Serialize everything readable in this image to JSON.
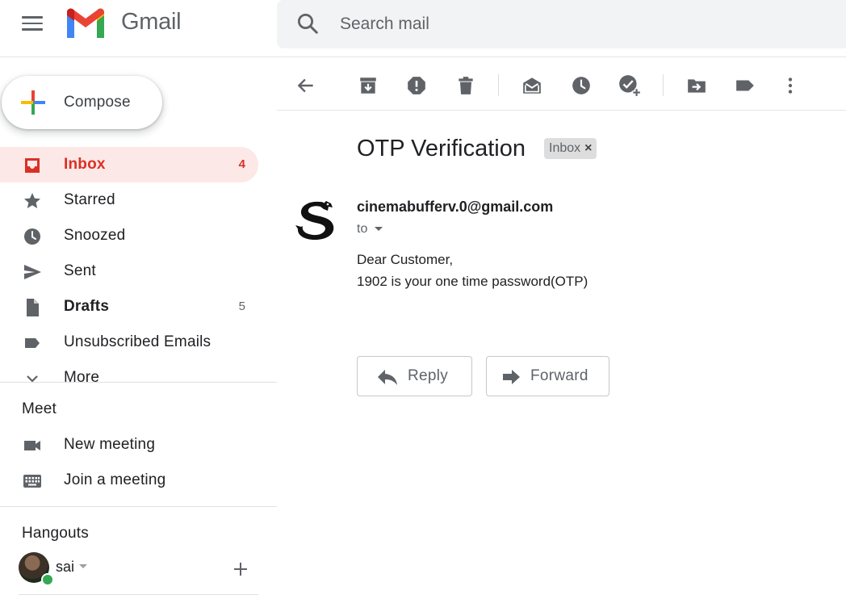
{
  "app": {
    "name": "Gmail"
  },
  "search": {
    "placeholder": "Search mail"
  },
  "compose": {
    "label": "Compose"
  },
  "sidebar": {
    "items": [
      {
        "label": "Inbox",
        "count": "4",
        "icon": "inbox-icon",
        "active": true
      },
      {
        "label": "Starred",
        "count": "",
        "icon": "star-icon"
      },
      {
        "label": "Snoozed",
        "count": "",
        "icon": "clock-icon"
      },
      {
        "label": "Sent",
        "count": "",
        "icon": "send-icon"
      },
      {
        "label": "Drafts",
        "count": "5",
        "icon": "draft-icon"
      },
      {
        "label": "Unsubscribed Emails",
        "count": "",
        "icon": "label-icon"
      },
      {
        "label": "More",
        "count": "",
        "icon": "chevron-down-icon"
      }
    ]
  },
  "meet": {
    "title": "Meet",
    "items": [
      {
        "label": "New meeting",
        "icon": "videocam-icon"
      },
      {
        "label": "Join a meeting",
        "icon": "keyboard-icon"
      }
    ]
  },
  "hangouts": {
    "title": "Hangouts",
    "user": "sai",
    "status": "online"
  },
  "toolbar": {
    "icons": [
      "back-arrow-icon",
      "archive-icon",
      "report-spam-icon",
      "delete-icon",
      "mark-unread-icon",
      "snooze-icon",
      "add-to-tasks-icon",
      "move-to-icon",
      "labels-icon",
      "more-vert-icon"
    ]
  },
  "message": {
    "subject": "OTP Verification",
    "label": "Inbox",
    "sender": "cinemabufferv.0@gmail.com",
    "to": "to",
    "body": [
      "Dear Customer,",
      "1902 is your one time password(OTP)"
    ]
  },
  "actions": {
    "reply": "Reply",
    "forward": "Forward"
  },
  "colors": {
    "accent_red": "#d93025",
    "active_bg": "#fce8e6",
    "icon_gray": "#5f6368",
    "search_bg": "#f1f3f4",
    "online_green": "#34a853"
  }
}
